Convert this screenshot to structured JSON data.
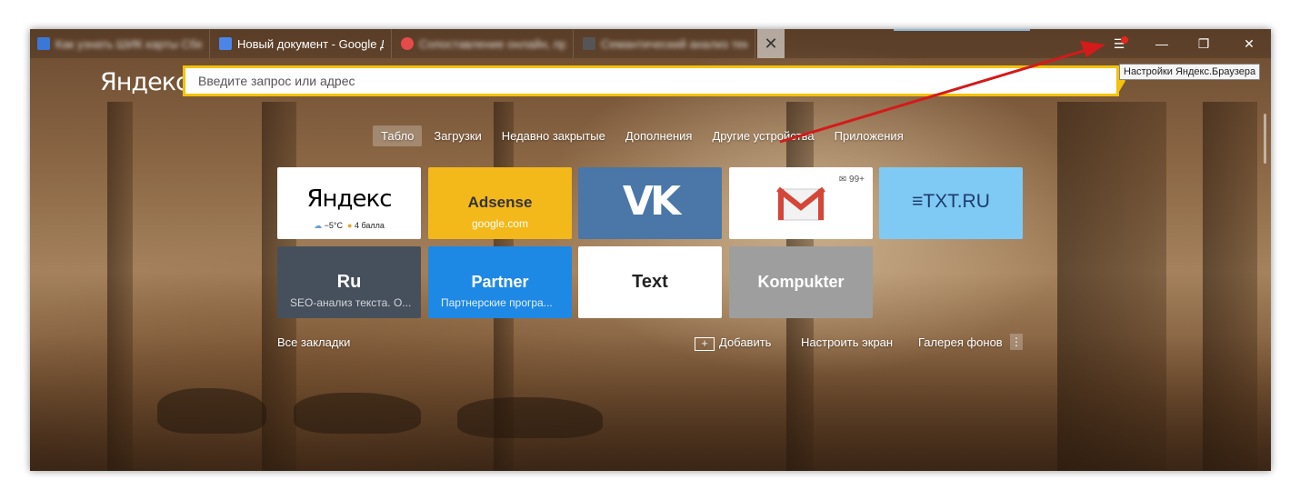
{
  "tabs": [
    {
      "title": "Как узнать ШИК карты Сбе",
      "blurred": true,
      "favicon_color": "#3a78d8"
    },
    {
      "title": "Новый документ - Google Д",
      "blurred": false,
      "favicon_color": "#4a86e8"
    },
    {
      "title": "Сопоставление онлайн, просм",
      "blurred": true,
      "favicon_color": "#e54b4b"
    },
    {
      "title": "Семантический анализ текс",
      "blurred": true,
      "favicon_color": "#555555"
    }
  ],
  "tab_close_icon": "close-icon",
  "window_controls": {
    "menu_icon": "menu-icon",
    "minimize_icon": "minimize-icon",
    "restore_icon": "restore-icon",
    "close_icon": "close-icon"
  },
  "tooltip": "Настройки Яндекс.Браузера",
  "logo": "Яндекс",
  "search": {
    "placeholder": "Введите запрос или адрес",
    "value": ""
  },
  "nav_tabs": [
    "Табло",
    "Загрузки",
    "Недавно закрытые",
    "Дополнения",
    "Другие устройства",
    "Приложения"
  ],
  "tiles": {
    "yandex": {
      "logo": "Яндекс",
      "weather": "−5°C",
      "traffic": "4 балла"
    },
    "adsense": {
      "title": "Adsense",
      "subtitle": "google.com"
    },
    "vk": {
      "logo": "VK"
    },
    "gmail": {
      "badge": "99+"
    },
    "etxt": {
      "logo": "TXT.RU"
    },
    "ru": {
      "title": "Ru",
      "subtitle": "SEO-анализ текста. О..."
    },
    "partner": {
      "title": "Partner",
      "subtitle": "Партнерские програ..."
    },
    "text": {
      "title": "Text"
    },
    "kompukter": {
      "title": "Kompukter"
    }
  },
  "footer": {
    "all_bookmarks": "Все закладки",
    "add": "Добавить",
    "customize": "Настроить экран",
    "gallery": "Галерея фонов",
    "more_icon": "more-vertical-icon"
  },
  "colors": {
    "accent": "#f3c20a",
    "adsense": "#f3b81a",
    "vk": "#4a76a8",
    "etxt": "#7fcaf5",
    "ru": "#46505c",
    "partner": "#1e88e5",
    "kompukter": "#9e9e9e",
    "arrow": "#d41a1a",
    "menu_badge": "#e52620"
  }
}
